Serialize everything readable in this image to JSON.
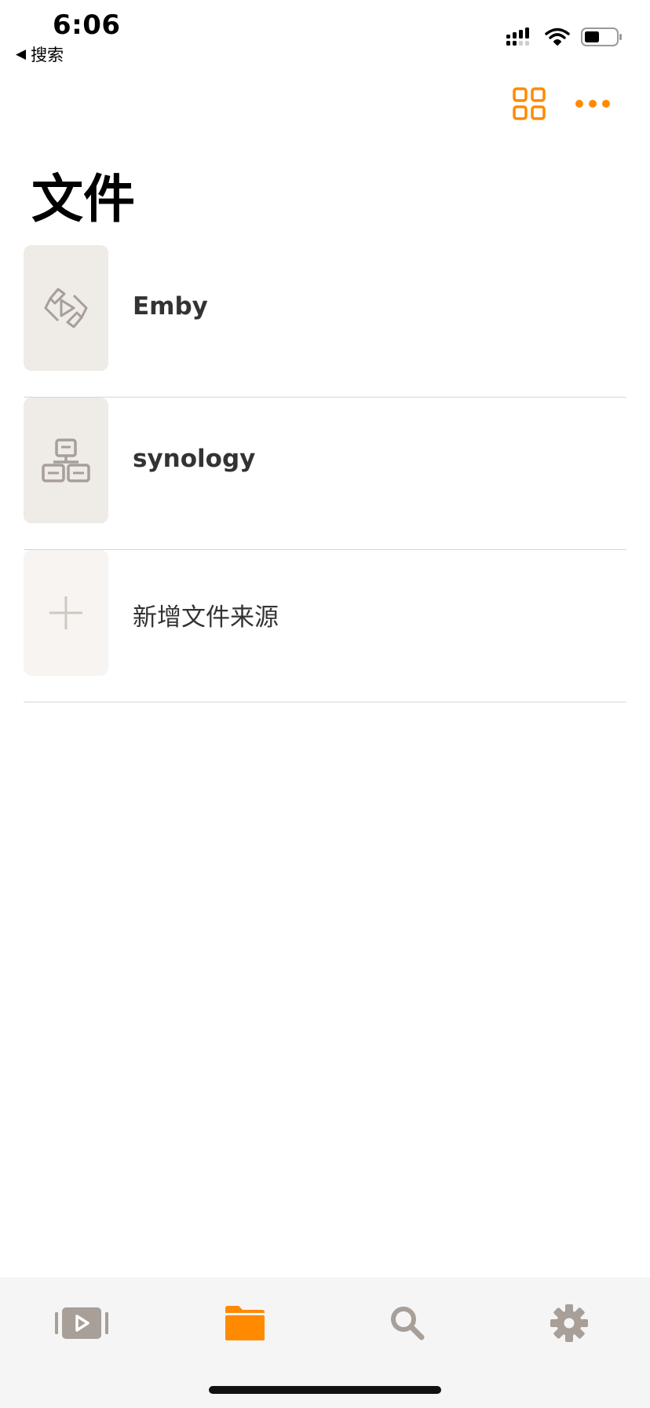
{
  "status": {
    "time": "6:06",
    "back_label": "搜索",
    "icons": [
      "signal-icon",
      "wifi-icon",
      "battery-icon"
    ]
  },
  "toolbar": {
    "icons": [
      "grid-view-icon",
      "more-icon"
    ]
  },
  "page": {
    "title": "文件"
  },
  "sources": [
    {
      "label": "Emby",
      "icon": "emby-icon"
    },
    {
      "label": "synology",
      "icon": "network-icon"
    },
    {
      "label": "新增文件来源",
      "icon": "plus-icon"
    }
  ],
  "tabbar": {
    "tabs": [
      {
        "name": "videos",
        "icon": "video-icon"
      },
      {
        "name": "files",
        "icon": "folder-icon",
        "active": true
      },
      {
        "name": "search",
        "icon": "search-icon"
      },
      {
        "name": "settings",
        "icon": "gear-icon"
      }
    ]
  },
  "colors": {
    "accent": "#ff8a00",
    "icon_gray": "#a79f98",
    "thumb_bg": "#efebe6",
    "tabbar_bg": "#f5f5f5"
  }
}
